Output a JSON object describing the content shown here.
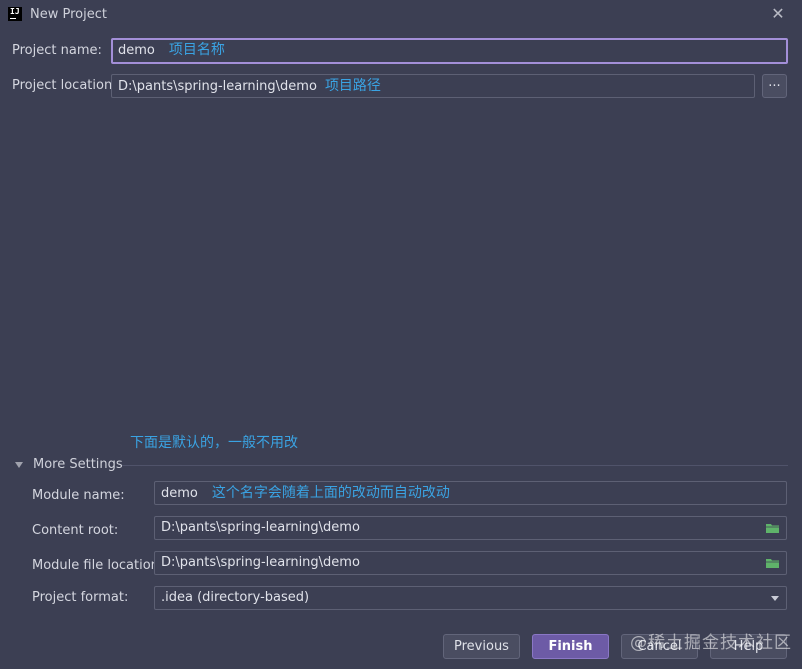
{
  "window": {
    "title": "New Project",
    "app_icon_text": "IJ"
  },
  "project": {
    "name_label": "Project name:",
    "name_value": "demo",
    "name_annotation": "项目名称",
    "location_label": "Project location:",
    "location_value": "D:\\pants\\spring-learning\\demo",
    "location_annotation": "项目路径",
    "browse_label": "..."
  },
  "note": "下面是默认的，一般不用改",
  "more_settings": {
    "title": "More Settings",
    "module_name_label": "Module name:",
    "module_name_value": "demo",
    "module_name_annotation": "这个名字会随着上面的改动而自动改动",
    "content_root_label": "Content root:",
    "content_root_value": "D:\\pants\\spring-learning\\demo",
    "module_file_label": "Module file location:",
    "module_file_value": "D:\\pants\\spring-learning\\demo",
    "format_label": "Project format:",
    "format_value": ".idea (directory-based)"
  },
  "buttons": {
    "previous": "Previous",
    "finish": "Finish",
    "cancel": "Cancel",
    "help": "Help"
  },
  "watermark": "@稀土掘金技术社区",
  "icons": {
    "close": "close-icon",
    "folder": "folder-icon",
    "collapse": "triangle-down-icon",
    "dropdown": "chevron-down-icon"
  },
  "colors": {
    "background": "#3c3f53",
    "accent": "#6d5ba6",
    "focus_border": "#a38fd8",
    "annotation": "#3aa3e3",
    "folder": "#5fb36a"
  }
}
